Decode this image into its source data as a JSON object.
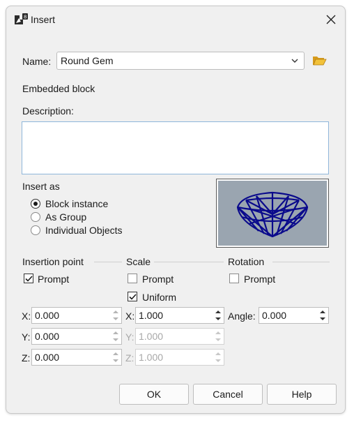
{
  "window": {
    "title": "Insert"
  },
  "name_field": {
    "label": "Name:",
    "value": "Round Gem"
  },
  "block_type": "Embedded block",
  "description": {
    "label": "Description:",
    "value": ""
  },
  "insert_as": {
    "label": "Insert as",
    "options": [
      "Block instance",
      "As Group",
      "Individual Objects"
    ],
    "selected": "Block instance"
  },
  "insertion_point": {
    "label": "Insertion point",
    "prompt_label": "Prompt",
    "prompt_checked": true,
    "x_label": "X:",
    "x": "0.000",
    "y_label": "Y:",
    "y": "0.000",
    "z_label": "Z:",
    "z": "0.000"
  },
  "scale": {
    "label": "Scale",
    "prompt_label": "Prompt",
    "prompt_checked": false,
    "uniform_label": "Uniform",
    "uniform_checked": true,
    "x_label": "X:",
    "x": "1.000",
    "y_label": "Y:",
    "y": "1.000",
    "z_label": "Z:",
    "z": "1.000"
  },
  "rotation": {
    "label": "Rotation",
    "prompt_label": "Prompt",
    "prompt_checked": false,
    "angle_label": "Angle:",
    "angle": "0.000"
  },
  "buttons": {
    "ok": "OK",
    "cancel": "Cancel",
    "help": "Help"
  },
  "colors": {
    "preview_bg": "#9aa5b0",
    "gem_wire": "#0a0a8c",
    "focus_border": "#8fb6da"
  },
  "icons": [
    "app-icon",
    "close-icon",
    "chevron-down-icon",
    "folder-open-icon",
    "check-icon",
    "spin-up-icon",
    "spin-down-icon"
  ]
}
